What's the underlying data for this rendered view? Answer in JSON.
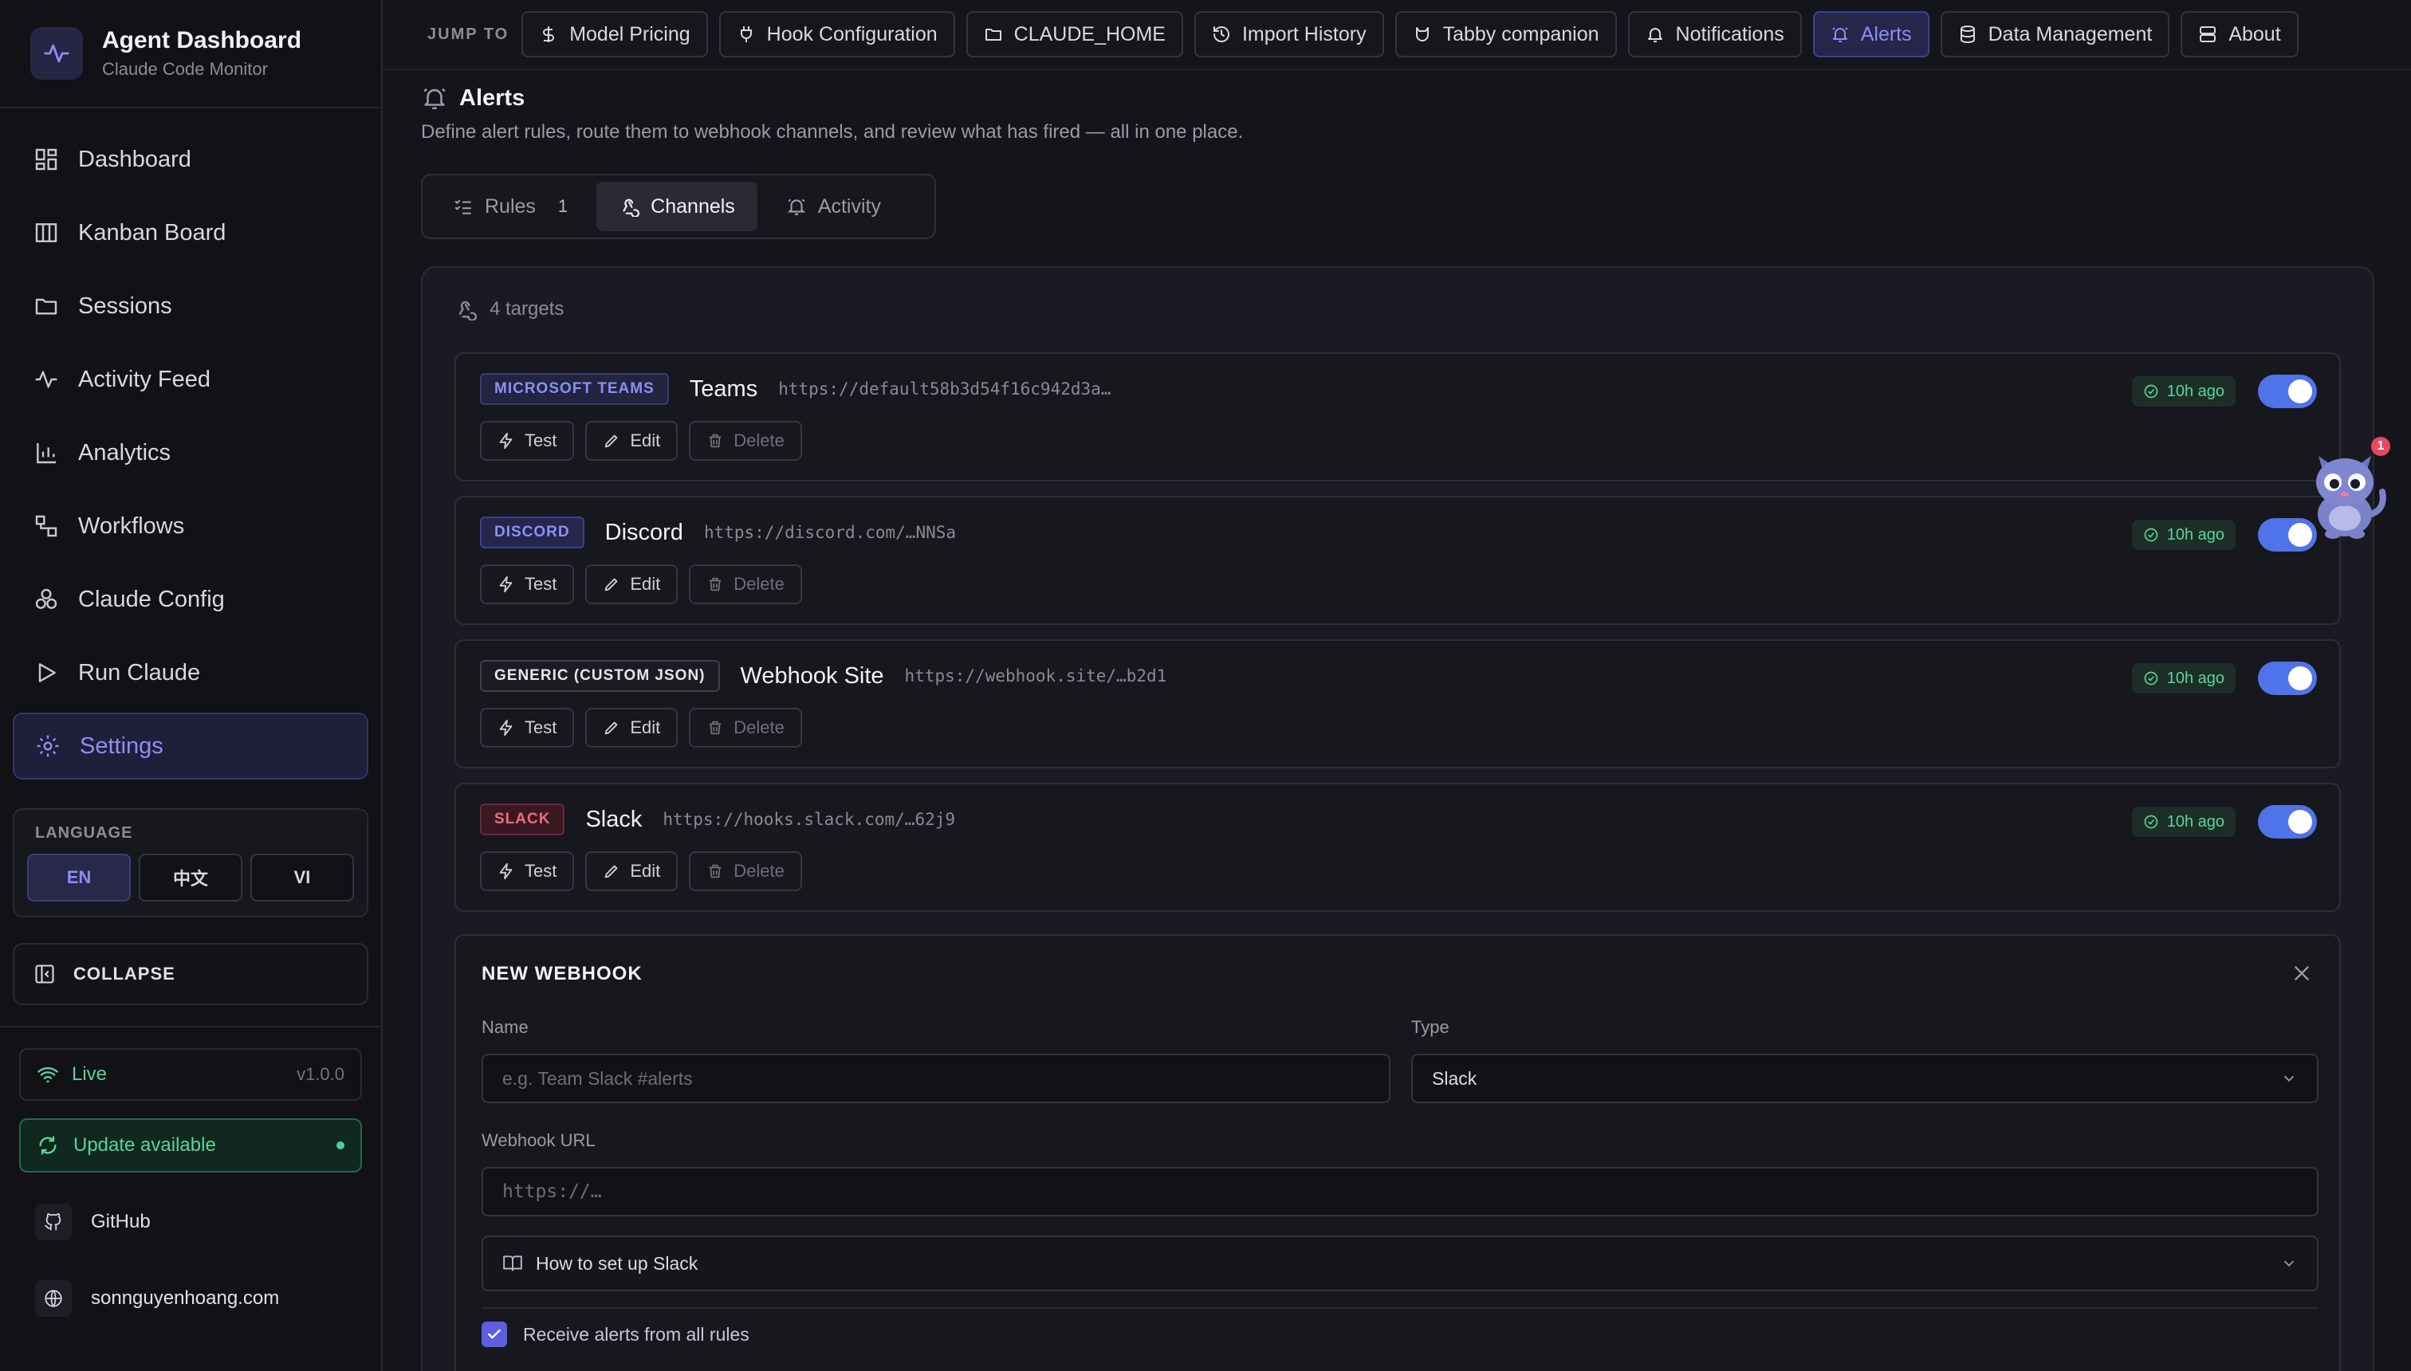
{
  "app": {
    "title": "Agent Dashboard",
    "subtitle": "Claude Code Monitor"
  },
  "sidebar": {
    "items": [
      {
        "label": "Dashboard",
        "icon": "grid-icon"
      },
      {
        "label": "Kanban Board",
        "icon": "columns-icon"
      },
      {
        "label": "Sessions",
        "icon": "folder-icon"
      },
      {
        "label": "Activity Feed",
        "icon": "activity-icon"
      },
      {
        "label": "Analytics",
        "icon": "bar-chart-icon"
      },
      {
        "label": "Workflows",
        "icon": "workflow-icon"
      },
      {
        "label": "Claude Config",
        "icon": "config-icon"
      },
      {
        "label": "Run Claude",
        "icon": "play-icon"
      },
      {
        "label": "Settings",
        "icon": "gear-icon",
        "active": true
      }
    ],
    "language": {
      "title": "LANGUAGE",
      "options": [
        "EN",
        "中文",
        "VI"
      ],
      "selected": "EN"
    },
    "collapse_label": "COLLAPSE",
    "status": {
      "label": "Live",
      "version": "v1.0.0"
    },
    "update_label": "Update available",
    "links": [
      {
        "label": "GitHub",
        "icon": "github-icon"
      },
      {
        "label": "sonnguyenhoang.com",
        "icon": "globe-icon"
      }
    ]
  },
  "jumpbar": {
    "label": "JUMP TO",
    "items": [
      {
        "label": "Model Pricing",
        "icon": "dollar-icon"
      },
      {
        "label": "Hook Configuration",
        "icon": "plug-icon"
      },
      {
        "label": "CLAUDE_HOME",
        "icon": "folder-icon"
      },
      {
        "label": "Import History",
        "icon": "history-icon"
      },
      {
        "label": "Tabby companion",
        "icon": "cat-icon"
      },
      {
        "label": "Notifications",
        "icon": "bell-icon"
      },
      {
        "label": "Alerts",
        "icon": "bell-ring-icon",
        "active": true
      },
      {
        "label": "Data Management",
        "icon": "database-icon"
      },
      {
        "label": "About",
        "icon": "server-icon"
      }
    ]
  },
  "page": {
    "title": "Alerts",
    "description": "Define alert rules, route them to webhook channels, and review what has fired — all in one place."
  },
  "tabs": [
    {
      "label": "Rules",
      "count": "1"
    },
    {
      "label": "Channels",
      "active": true
    },
    {
      "label": "Activity"
    }
  ],
  "channels": {
    "count_label": "4 targets",
    "items": [
      {
        "type": "MICROSOFT TEAMS",
        "name": "Teams",
        "url": "https://default58b3d54f16c942d3a…",
        "time": "10h ago",
        "enabled": true,
        "badge_bg": "#222440",
        "badge_border": "#3a3d72",
        "badge_color": "#8d8ff5"
      },
      {
        "type": "DISCORD",
        "name": "Discord",
        "url": "https://discord.com/…NNSa",
        "time": "10h ago",
        "enabled": true,
        "badge_bg": "#25264a",
        "badge_border": "#3e4090",
        "badge_color": "#8d8ff5"
      },
      {
        "type": "GENERIC (CUSTOM JSON)",
        "name": "Webhook Site",
        "url": "https://webhook.site/…b2d1",
        "time": "10h ago",
        "enabled": true,
        "badge_bg": "#1b1b22",
        "badge_border": "#40404c",
        "badge_color": "#e6e6ee"
      },
      {
        "type": "SLACK",
        "name": "Slack",
        "url": "https://hooks.slack.com/…62j9",
        "time": "10h ago",
        "enabled": true,
        "badge_bg": "#3a1822",
        "badge_border": "#6a2838",
        "badge_color": "#f06a82"
      }
    ],
    "actions": {
      "test": "Test",
      "edit": "Edit",
      "delete": "Delete"
    }
  },
  "new_webhook": {
    "title": "NEW WEBHOOK",
    "name_label": "Name",
    "name_placeholder": "e.g. Team Slack #alerts",
    "type_label": "Type",
    "type_value": "Slack",
    "url_label": "Webhook URL",
    "url_placeholder": "https://…",
    "howto_label": "How to set up Slack",
    "all_rules_label": "Receive alerts from all rules",
    "all_rules_checked": true
  },
  "mascot": {
    "notification_count": "1"
  },
  "colors": {
    "accent": "#8d8ff5",
    "success": "#5ad49a",
    "toggle": "#4f73e8",
    "danger": "#f06a82"
  }
}
